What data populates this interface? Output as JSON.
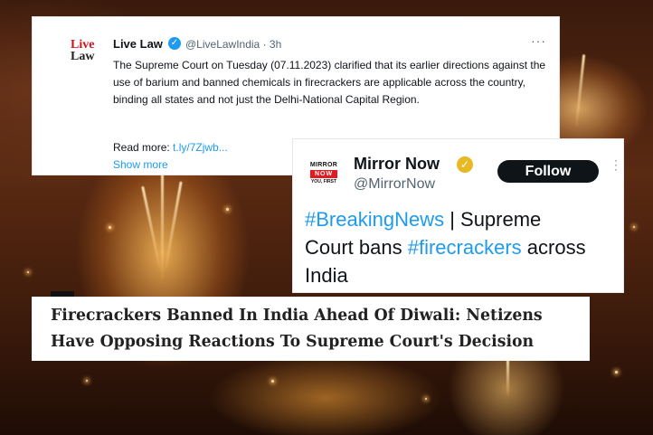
{
  "livelaw_tweet": {
    "logo_line1": "Live",
    "logo_line2": "Law",
    "name": "Live Law",
    "verified": "✓",
    "handle_time": "@LiveLawIndia · 3h",
    "more": "···",
    "body": "The Supreme Court on Tuesday (07.11.2023) clarified that its earlier directions against the use of barium and banned chemicals in firecrackers are applicable across the country, binding all states and not just the Delhi-National Capital Region.",
    "read_more_label": "Read more: ",
    "read_more_link": "t.ly/7Zjwb...",
    "show_more": "Show more"
  },
  "mirror_tweet": {
    "logo_top": "MIRROR",
    "logo_mid": "NOW",
    "logo_bottom": "YOU, FIRST",
    "name": "Mirror Now",
    "badge": "✓",
    "handle": "@MirrorNow",
    "follow": "Follow",
    "more": "⋮",
    "hashtag1": "#BreakingNews",
    "text1": " | Supreme Court bans ",
    "hashtag2": "#firecrackers",
    "text2": " across India"
  },
  "headline": {
    "line1": "Firecrackers Banned In India Ahead Of Diwali: Netizens",
    "line2": "Have Opposing Reactions To Supreme Court's Decision"
  },
  "colors": {
    "link_blue": "#1d9bf0",
    "text_dark": "#0f1419",
    "muted": "#536471",
    "livelaw_red": "#d0121b",
    "mirror_red": "#e11b22",
    "gold_badge": "#e8b923"
  },
  "icons": [
    "verified-badge-icon",
    "more-options-icon",
    "gold-verified-icon",
    "vertical-more-icon"
  ]
}
